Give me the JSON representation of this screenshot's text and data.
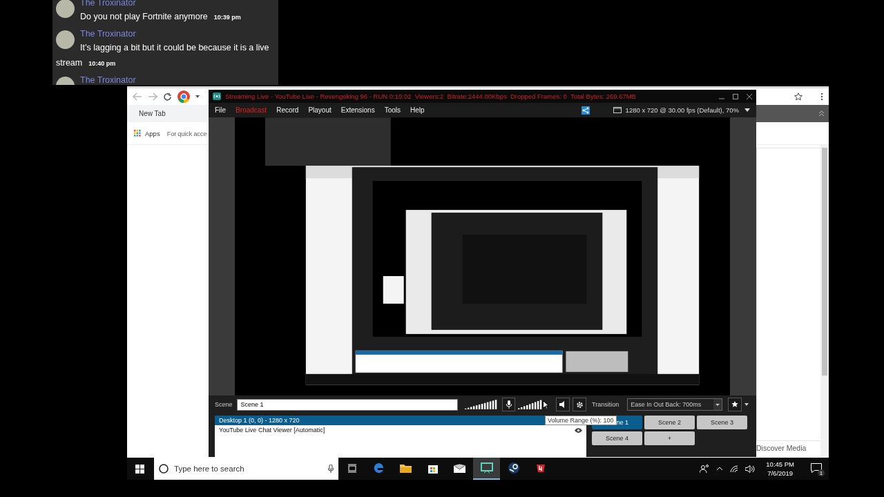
{
  "chat": {
    "messages": [
      {
        "author": "The Troxinator",
        "text": "Do you not play Fortnite anymore",
        "time": "10:39 pm"
      },
      {
        "author": "The Troxinator",
        "text": "It’s lagging a bit but it could be because it is a live stream",
        "time": "10:40 pm"
      },
      {
        "author": "The Troxinator"
      }
    ]
  },
  "browser": {
    "tab": "New Tab",
    "bookmarks": [
      "Apps",
      "For quick acce"
    ],
    "side_link": "Discover Media"
  },
  "xsplit": {
    "title": "Streaming Live - YouTube Live - Revengeking 96 - RUN 0:15:02  Viewers:2  Bitrate:2444.00Kbps  Dropped Frames: 0  Total Bytes: 269.67MB",
    "menu": [
      {
        "label": "File",
        "highlighted": false
      },
      {
        "label": "Broadcast",
        "highlighted": true
      },
      {
        "label": "Record",
        "highlighted": false
      },
      {
        "label": "Playout",
        "highlighted": false
      },
      {
        "label": "Extensions",
        "highlighted": false
      },
      {
        "label": "Tools",
        "highlighted": false
      },
      {
        "label": "Help",
        "highlighted": false
      }
    ],
    "resolution": "1280 x 720 @ 30.00 fps (Default), 70%",
    "scene_label": "Scene",
    "scene_name": "Scene 1",
    "sources": [
      {
        "label": "Desktop 1 (0, 0) - 1280 x 720",
        "selected": true
      },
      {
        "label": "YouTube Live Chat Viewer [Automatic]",
        "selected": false
      }
    ],
    "tooltip": "Volume Range (%): 100",
    "transition_label": "Transition",
    "transition": "Ease In Out Back: 700ms",
    "scenes": [
      {
        "label": "ne 1",
        "selected": true
      },
      {
        "label": "Scene 2",
        "selected": false
      },
      {
        "label": "Scene 3",
        "selected": false
      },
      {
        "label": "Scene 4",
        "selected": false
      },
      {
        "label": "+",
        "selected": false
      }
    ]
  },
  "taskbar": {
    "search_placeholder": "Type here to search",
    "apps": [
      {
        "kind": "task-view",
        "active": false
      },
      {
        "kind": "edge",
        "active": false
      },
      {
        "kind": "folder",
        "active": false
      },
      {
        "kind": "store",
        "active": false
      },
      {
        "kind": "mail",
        "active": false
      },
      {
        "kind": "xsplit",
        "active": true
      },
      {
        "kind": "steam",
        "active": false
      },
      {
        "kind": "red-app",
        "active": false
      }
    ],
    "time": "10:45 PM",
    "date": "7/6/2019",
    "notification_count": "1"
  }
}
